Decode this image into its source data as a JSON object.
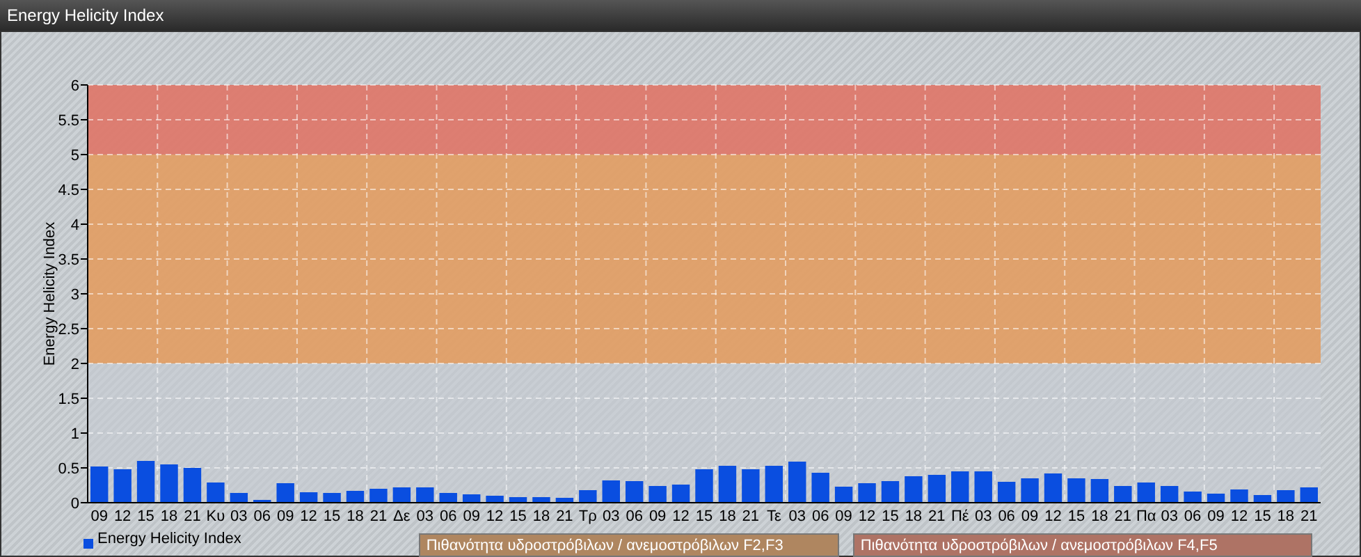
{
  "window": {
    "title": "Energy Helicity Index"
  },
  "chart": {
    "chart_data": {
      "type": "bar",
      "ylabel": "Energy Helicity Index",
      "categories": [
        "09",
        "12",
        "15",
        "18",
        "21",
        "Κυ",
        "03",
        "06",
        "09",
        "12",
        "15",
        "18",
        "21",
        "Δε",
        "03",
        "06",
        "09",
        "12",
        "15",
        "18",
        "21",
        "Τρ",
        "03",
        "06",
        "09",
        "12",
        "15",
        "18",
        "21",
        "Τε",
        "03",
        "06",
        "09",
        "12",
        "15",
        "18",
        "21",
        "Πέ",
        "03",
        "06",
        "09",
        "12",
        "15",
        "18",
        "21",
        "Πα",
        "03",
        "06",
        "09",
        "12",
        "15",
        "18",
        "21"
      ],
      "series": [
        {
          "name": "Energy Helicity Index",
          "color": "#0a4ee0",
          "values": [
            0.52,
            0.48,
            0.6,
            0.55,
            0.5,
            0.29,
            0.14,
            0.04,
            0.28,
            0.15,
            0.14,
            0.17,
            0.2,
            0.22,
            0.22,
            0.14,
            0.12,
            0.1,
            0.08,
            0.08,
            0.07,
            0.18,
            0.32,
            0.31,
            0.24,
            0.26,
            0.48,
            0.53,
            0.48,
            0.53,
            0.59,
            0.43,
            0.23,
            0.28,
            0.31,
            0.38,
            0.4,
            0.45,
            0.45,
            0.3,
            0.35,
            0.42,
            0.35,
            0.34,
            0.24,
            0.29,
            0.24,
            0.16,
            0.13,
            0.19,
            0.11,
            0.18,
            0.22
          ]
        }
      ],
      "ylim": [
        0,
        6
      ],
      "yticks": [
        0,
        0.5,
        1,
        1.5,
        2,
        2.5,
        3,
        3.5,
        4,
        4.5,
        5,
        5.5,
        6
      ],
      "grid": true,
      "bands": [
        {
          "axis": "y",
          "from": 2,
          "to": 5,
          "color": "#e49a5a"
        },
        {
          "axis": "y",
          "from": 5,
          "to": 6,
          "color": "#e07060"
        }
      ]
    },
    "band_notes": [
      {
        "label": "Πιθανότητα υδροστρόβιλων / ανεμοστρόβιλων F2,F3",
        "color": "#af8660"
      },
      {
        "label": "Πιθανότητα υδροστρόβιλων / ανεμοστρόβιλων F4,F5",
        "color": "#ae7365"
      }
    ]
  }
}
